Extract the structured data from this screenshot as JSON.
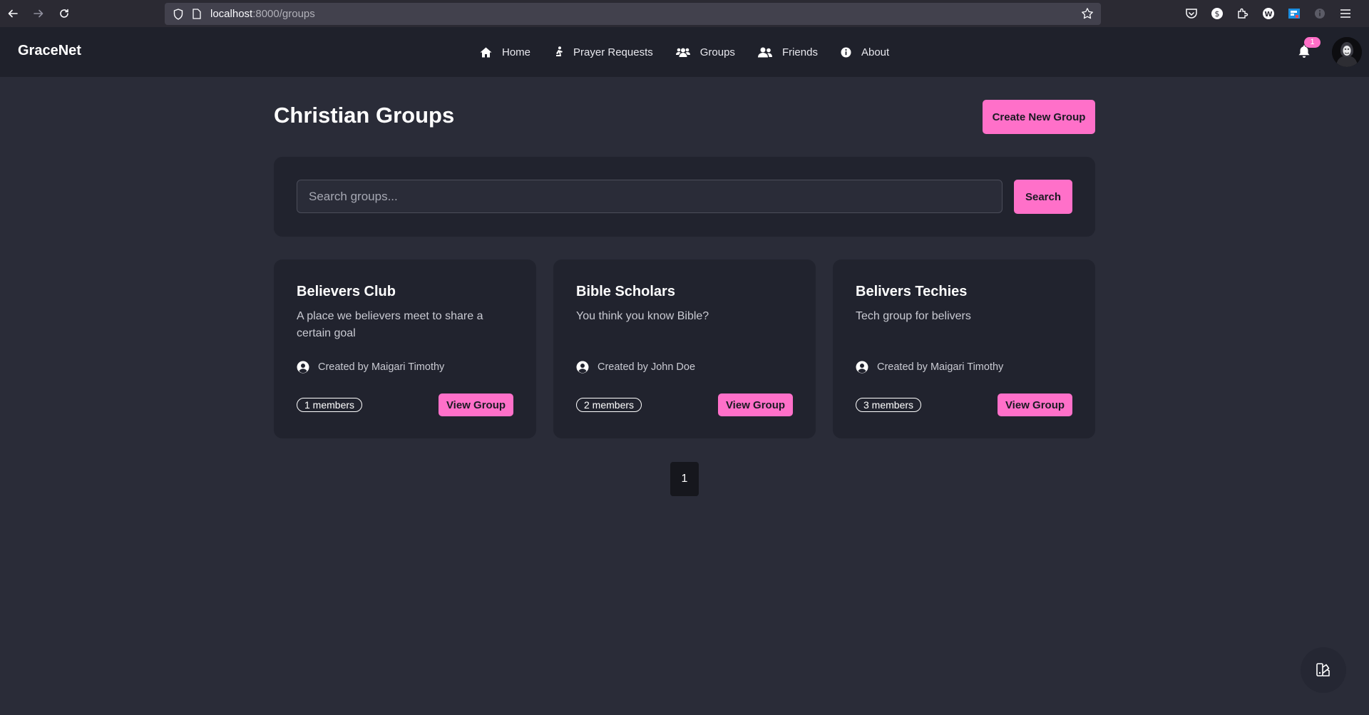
{
  "browser": {
    "url_host": "localhost",
    "url_path": ":8000/groups"
  },
  "nav": {
    "brand": "GraceNet",
    "links": [
      {
        "label": "Home",
        "icon": "home-icon"
      },
      {
        "label": "Prayer Requests",
        "icon": "praying-icon"
      },
      {
        "label": "Groups",
        "icon": "users-icon"
      },
      {
        "label": "Friends",
        "icon": "user-friends-icon"
      },
      {
        "label": "About",
        "icon": "info-icon"
      }
    ],
    "notification_count": "1"
  },
  "page": {
    "title": "Christian Groups",
    "create_button": "Create New Group"
  },
  "search": {
    "placeholder": "Search groups...",
    "button": "Search"
  },
  "groups": [
    {
      "name": "Believers Club",
      "description": "A place we believers meet to share a certain goal",
      "creator": "Created by Maigari Timothy",
      "members": "1 members",
      "button": "View Group"
    },
    {
      "name": "Bible Scholars",
      "description": "You think you know Bible?",
      "creator": "Created by John Doe",
      "members": "2 members",
      "button": "View Group"
    },
    {
      "name": "Belivers Techies",
      "description": "Tech group for belivers",
      "creator": "Created by Maigari Timothy",
      "members": "3 members",
      "button": "View Group"
    }
  ],
  "pagination": {
    "current": "1"
  },
  "colors": {
    "accent": "#ff70c9",
    "background": "#2a2c38",
    "card": "#21232e",
    "navbar": "#1f212b"
  }
}
